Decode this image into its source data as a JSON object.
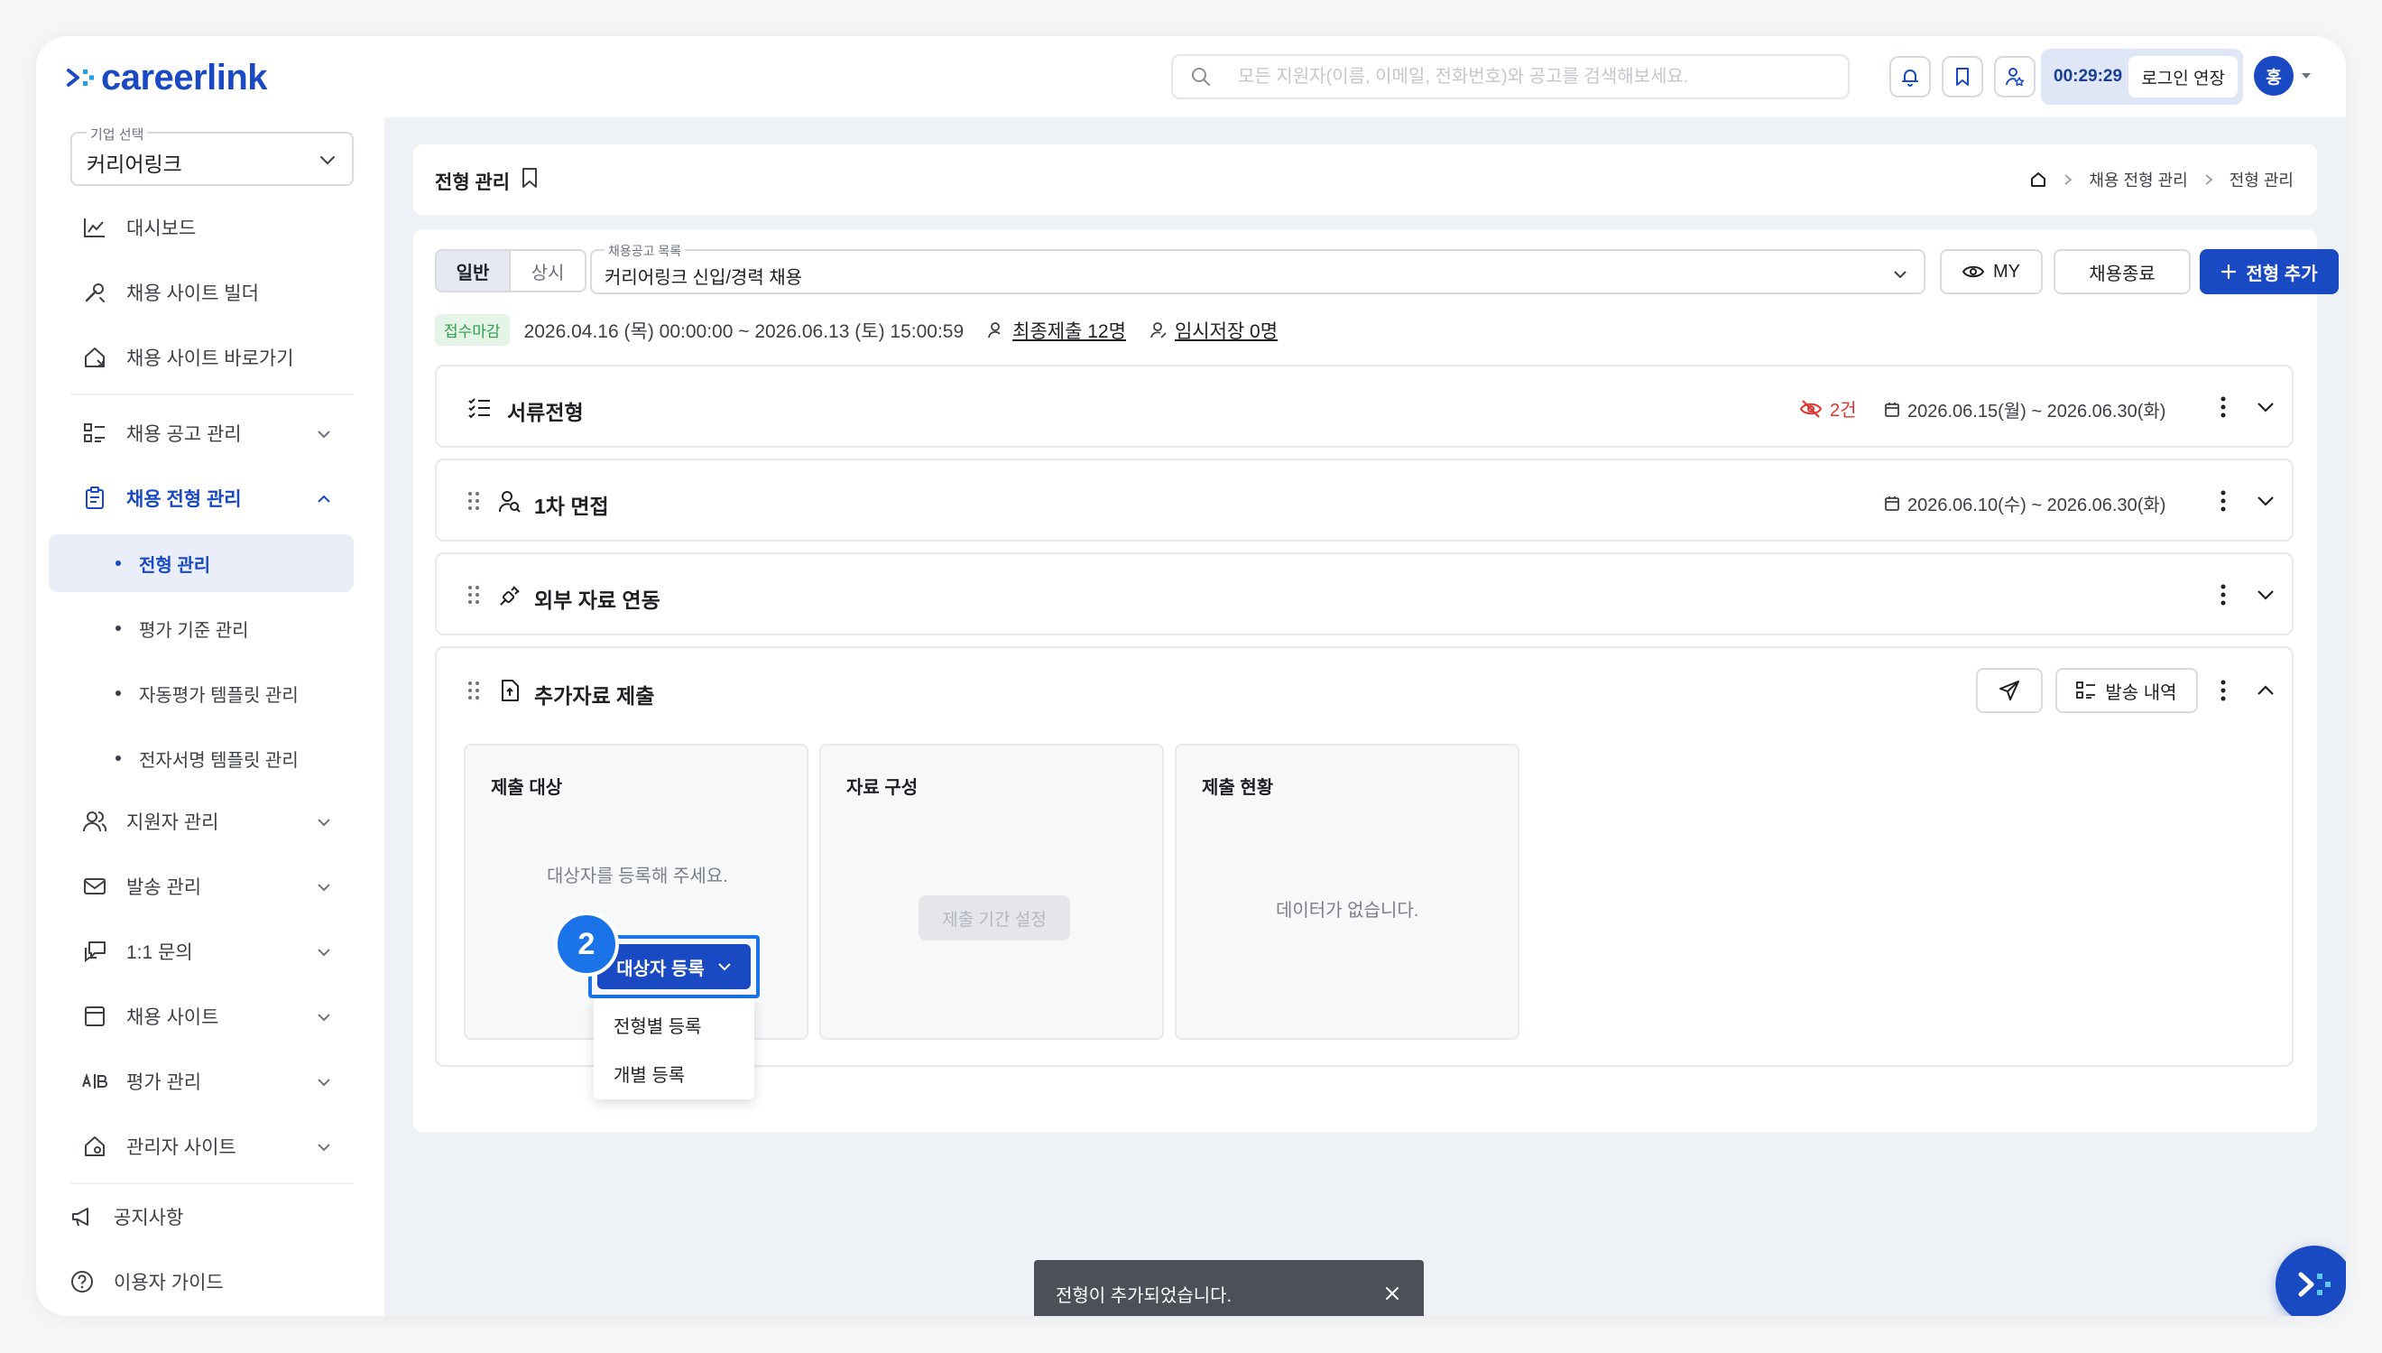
{
  "header": {
    "logo_text": "careerlink",
    "search_placeholder": "모든 지원자(이름, 이메일, 전화번호)와 공고를 검색해보세요.",
    "session_timer": "00:29:29",
    "extend_label": "로그인 연장",
    "avatar_initial": "홍"
  },
  "sidebar": {
    "company_label": "기업 선택",
    "company_name": "커리어링크",
    "items": [
      {
        "label": "대시보드"
      },
      {
        "label": "채용 사이트 빌더"
      },
      {
        "label": "채용 사이트 바로가기"
      },
      {
        "label": "채용 공고 관리"
      },
      {
        "label": "채용 전형 관리"
      },
      {
        "label": "지원자 관리"
      },
      {
        "label": "발송 관리"
      },
      {
        "label": "1:1 문의"
      },
      {
        "label": "채용 사이트"
      },
      {
        "label": "평가 관리"
      },
      {
        "label": "관리자 사이트"
      },
      {
        "label": "공지사항"
      },
      {
        "label": "이용자 가이드"
      }
    ],
    "sub_items": [
      {
        "label": "전형 관리"
      },
      {
        "label": "평가 기준 관리"
      },
      {
        "label": "자동평가 템플릿 관리"
      },
      {
        "label": "전자서명 템플릿 관리"
      }
    ]
  },
  "breadcrumb": {
    "title": "전형 관리",
    "trail": [
      "채용 전형 관리",
      "전형 관리"
    ]
  },
  "toolbar": {
    "tab_general": "일반",
    "tab_always": "상시",
    "posting_label": "채용공고 목록",
    "posting_value": "커리어링크 신입/경력 채용",
    "my_label": "MY",
    "close_label": "채용종료",
    "add_stage_label": "전형 추가"
  },
  "meta": {
    "status_badge": "접수마감",
    "period": "2026.04.16 (목) 00:00:00 ~ 2026.06.13 (토) 15:00:59",
    "final_submit": "최종제출 12명",
    "temp_save": "임시저장 0명"
  },
  "stages": [
    {
      "title": "서류전형",
      "hidden_count": "2건",
      "dates": "2026.06.15(월) ~ 2026.06.30(화)"
    },
    {
      "title": "1차 면접",
      "dates": "2026.06.10(수) ~ 2026.06.30(화)"
    },
    {
      "title": "외부 자료 연동"
    },
    {
      "title": "추가자료 제출",
      "send_history_label": "발송 내역"
    }
  ],
  "panels": {
    "target_title": "제출 대상",
    "target_msg": "대상자를 등록해 주세요.",
    "register_label": "대상자 등록",
    "step_number": "2",
    "dropdown": [
      "전형별 등록",
      "개별 등록"
    ],
    "material_title": "자료 구성",
    "period_btn": "제출 기간 설정",
    "status_title": "제출 현황",
    "status_msg": "데이터가 없습니다."
  },
  "toast": {
    "message": "전형이 추가되었습니다."
  },
  "colors": {
    "brand": "#1a49c4",
    "accent": "#1a73e8",
    "danger": "#e0352b",
    "success": "#2f9e4f"
  }
}
